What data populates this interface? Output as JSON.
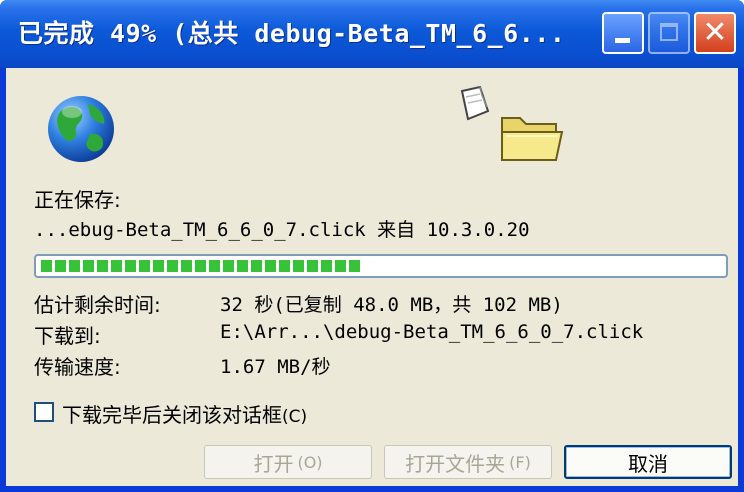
{
  "window": {
    "title": "已完成 49% (总共 debug-Beta_TM_6_6..."
  },
  "dialog": {
    "saving_label": "正在保存:",
    "saving_file": "...ebug-Beta_TM_6_6_0_7.click 来自 10.3.0.20",
    "progress_fraction": 0.49,
    "fields": [
      {
        "label": "估计剩余时间:",
        "value": "32 秒(已复制 48.0 MB，共 102 MB)"
      },
      {
        "label": "下载到:",
        "value": "E:\\Arr...\\debug-Beta_TM_6_6_0_7.click"
      },
      {
        "label": "传输速度:",
        "value": "1.67 MB/秒"
      }
    ],
    "checkbox_label": "下载完毕后关闭该对话框",
    "checkbox_accel": "(C)",
    "checkbox_checked": false
  },
  "buttons": {
    "open": "打开",
    "open_accel": "(O)",
    "open_folder": "打开文件夹",
    "open_folder_accel": "(F)",
    "cancel": "取消"
  },
  "colors": {
    "titlebar": "#0a4fd0",
    "client_bg": "#ece9d8",
    "progress_green": "#37c23a",
    "close_button": "#d2401e"
  },
  "icons": [
    "globe-icon",
    "paper-icon",
    "folder-icon",
    "minimize-icon",
    "maximize-icon",
    "close-icon"
  ]
}
